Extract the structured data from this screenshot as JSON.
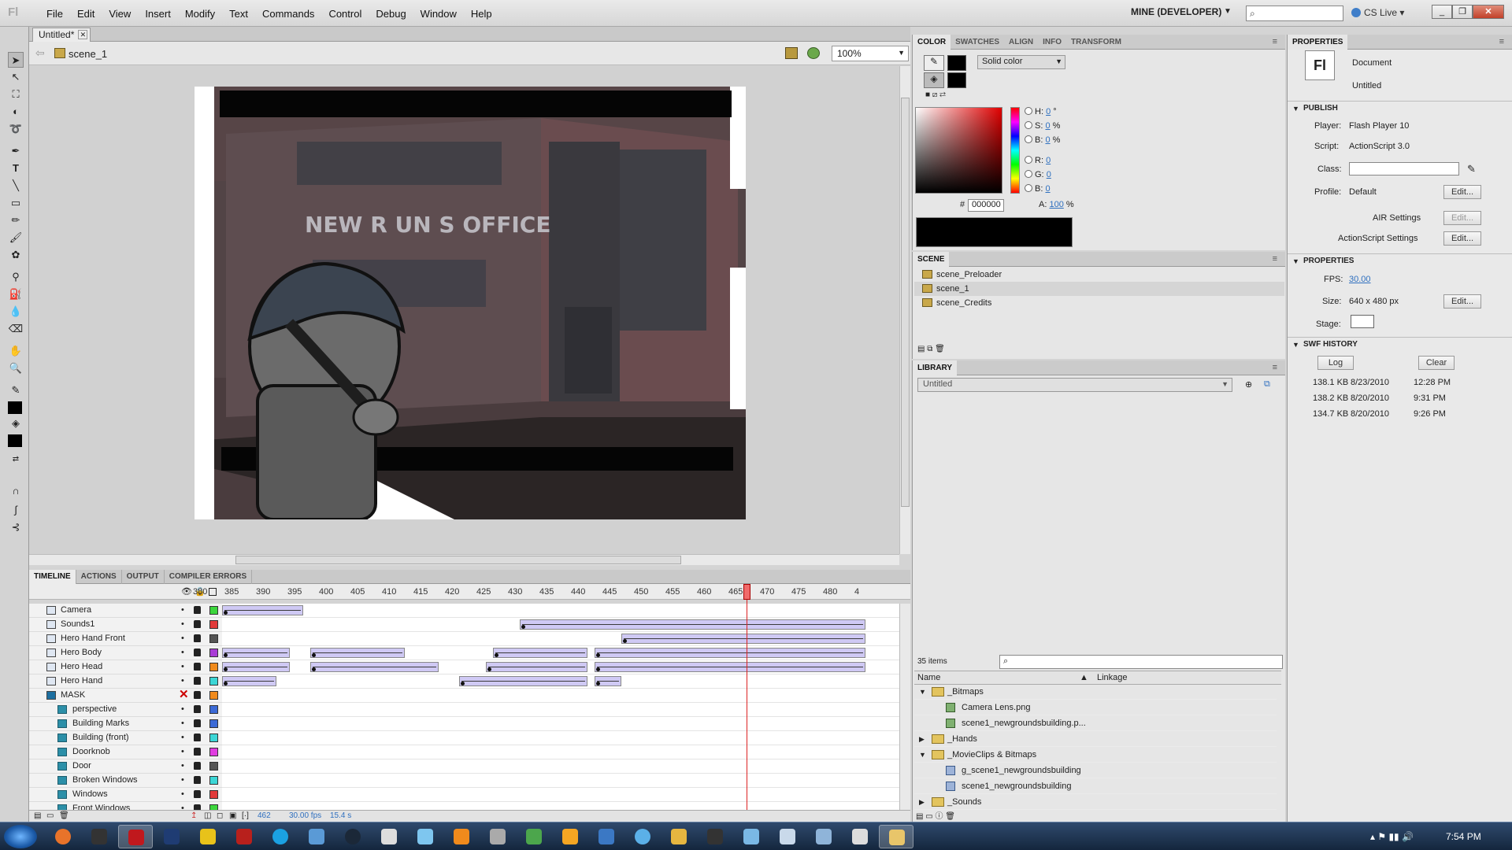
{
  "app": {
    "logo": "Fl",
    "menu": [
      "File",
      "Edit",
      "View",
      "Insert",
      "Modify",
      "Text",
      "Commands",
      "Control",
      "Debug",
      "Window",
      "Help"
    ],
    "workspace": "MINE (DEVELOPER)",
    "search_placeholder": "",
    "cs_live": "CS Live"
  },
  "document": {
    "tab": "Untitled*",
    "scene": "scene_1",
    "zoom": "100%"
  },
  "stage_art": {
    "sign_text": "NEW R UN S OFFICE"
  },
  "timeline": {
    "tabs": [
      "TIMELINE",
      "ACTIONS",
      "OUTPUT",
      "COMPILER ERRORS"
    ],
    "ruler": [
      "380",
      "385",
      "390",
      "395",
      "400",
      "405",
      "410",
      "415",
      "420",
      "425",
      "430",
      "435",
      "440",
      "445",
      "450",
      "455",
      "460",
      "465",
      "470",
      "475",
      "480",
      "4"
    ],
    "layers": [
      {
        "name": "Camera",
        "color": "#3cd63c",
        "type": "layer"
      },
      {
        "name": "Sounds1",
        "color": "#e23b3b",
        "type": "layer"
      },
      {
        "name": "Hero Hand Front",
        "color": "#555555",
        "type": "layer"
      },
      {
        "name": "Hero Body",
        "color": "#a93cd6",
        "type": "layer"
      },
      {
        "name": "Hero Head",
        "color": "#f08a1c",
        "type": "layer"
      },
      {
        "name": "Hero Hand",
        "color": "#3cd6d6",
        "type": "layer"
      },
      {
        "name": "MASK",
        "color": "#f08a1c",
        "type": "mask"
      },
      {
        "name": "perspective",
        "color": "#3c6ad6",
        "type": "sub"
      },
      {
        "name": "Building Marks",
        "color": "#3c6ad6",
        "type": "sub"
      },
      {
        "name": "Building (front)",
        "color": "#3cd6d6",
        "type": "sub"
      },
      {
        "name": "Doorknob",
        "color": "#e03ce0",
        "type": "sub"
      },
      {
        "name": "Door",
        "color": "#555555",
        "type": "sub"
      },
      {
        "name": "Broken Windows",
        "color": "#3cd6d6",
        "type": "sub"
      },
      {
        "name": "Windows",
        "color": "#e23b3b",
        "type": "sub"
      },
      {
        "name": "Front Windows",
        "color": "#3cd63c",
        "type": "sub"
      }
    ],
    "current_frame": "462",
    "fps": "30.00 fps",
    "time": "15.4 s"
  },
  "color_panel": {
    "tabs": [
      "COLOR",
      "SWATCHES",
      "ALIGN",
      "INFO",
      "TRANSFORM"
    ],
    "type": "Solid color",
    "h": "0",
    "s": "0",
    "b": "0",
    "r": "0",
    "g": "0",
    "bl": "0",
    "hex": "000000",
    "alpha": "100",
    "h_label": "H:",
    "s_label": "S:",
    "b_label": "B:",
    "r_label": "R:",
    "g_label": "G:",
    "bl_label": "B:",
    "a_label": "A:",
    "deg": "°",
    "pct": "%",
    "hash": "#"
  },
  "scene_panel": {
    "title": "SCENE",
    "scenes": [
      "scene_Preloader",
      "scene_1",
      "scene_Credits"
    ]
  },
  "library_panel": {
    "title": "LIBRARY",
    "doc": "Untitled",
    "count": "35 items",
    "col_name": "Name",
    "col_linkage": "Linkage",
    "items": [
      {
        "label": "_Bitmaps",
        "kind": "folder",
        "open": true
      },
      {
        "label": "Camera Lens.png",
        "kind": "bitmap"
      },
      {
        "label": "scene1_newgroundsbuilding.p...",
        "kind": "bitmap"
      },
      {
        "label": "_Hands",
        "kind": "folder",
        "open": false
      },
      {
        "label": "_MovieClips & Bitmaps",
        "kind": "folder",
        "open": true
      },
      {
        "label": "g_scene1_newgroundsbuilding",
        "kind": "clip"
      },
      {
        "label": "scene1_newgroundsbuilding",
        "kind": "clip"
      },
      {
        "label": "_Sounds",
        "kind": "folder",
        "open": false
      }
    ]
  },
  "properties_panel": {
    "title": "PROPERTIES",
    "doc_type": "Document",
    "doc_name": "Untitled",
    "publish": "PUBLISH",
    "player_label": "Player:",
    "player": "Flash Player 10",
    "script_label": "Script:",
    "script": "ActionScript 3.0",
    "class_label": "Class:",
    "profile_label": "Profile:",
    "profile": "Default",
    "edit": "Edit...",
    "air": "AIR Settings",
    "as_settings": "ActionScript Settings",
    "properties": "PROPERTIES",
    "fps_label": "FPS:",
    "fps": "30.00",
    "size_label": "Size:",
    "size": "640 x 480 px",
    "stage_label": "Stage:",
    "swf_history": "SWF HISTORY",
    "log": "Log",
    "clear": "Clear",
    "history": [
      {
        "size": "138.1 KB",
        "date": "8/23/2010",
        "time": "12:28 PM"
      },
      {
        "size": "138.2 KB",
        "date": "8/20/2010",
        "time": "9:31 PM"
      },
      {
        "size": "134.7 KB",
        "date": "8/20/2010",
        "time": "9:26 PM"
      }
    ]
  },
  "taskbar": {
    "clock": "7:54 PM"
  }
}
